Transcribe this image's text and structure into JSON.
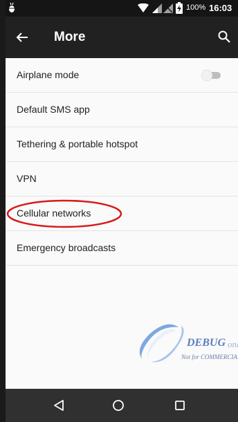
{
  "status_bar": {
    "battery_percent": "100%",
    "time": "16:03",
    "icons": [
      "debug-bug-icon",
      "wifi-icon",
      "cell-signal-icon",
      "no-sim-icon",
      "battery-charging-icon"
    ]
  },
  "toolbar": {
    "title": "More",
    "back_icon": "arrow-left-icon",
    "search_icon": "search-icon"
  },
  "list": {
    "items": [
      {
        "label": "Airplane mode",
        "toggle": {
          "on": false
        }
      },
      {
        "label": "Default SMS app"
      },
      {
        "label": "Tethering & portable hotspot"
      },
      {
        "label": "VPN"
      },
      {
        "label": "Cellular networks",
        "highlight_color": "#d81b1b"
      },
      {
        "label": "Emergency broadcasts"
      }
    ]
  },
  "watermark": {
    "text_main": "DEBUG",
    "text_suffix": "only",
    "text_sub": "Not for COMMERCIAL"
  },
  "nav_bar": {
    "back": "triangle-back-icon",
    "home": "circle-home-icon",
    "recents": "square-recents-icon"
  },
  "colors": {
    "status_bar": "#151515",
    "toolbar": "#212121",
    "background": "#fafafa",
    "nav_bar": "#303030",
    "circle_annotation": "#d81b1b"
  }
}
